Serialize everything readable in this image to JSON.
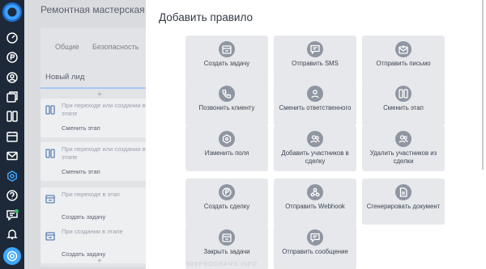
{
  "app": {
    "title": "Ремонтная мастерская",
    "tabs": [
      "Общие",
      "Безопасность"
    ],
    "stage": {
      "title": "Новый лид",
      "add_label": "+",
      "cards": [
        {
          "text": "При переходе или создании в этапе",
          "action": "Сменить этап",
          "icon": "stage-icon"
        },
        {
          "text": "При переходе или создании в этапе",
          "action": "Сменить этап",
          "icon": "stage-icon"
        },
        {
          "text": "При переходе в этап",
          "action": "Создать задачу",
          "icon": "task-icon"
        },
        {
          "text": "При создании в этапе",
          "action": "Создать задачу",
          "icon": "task-icon"
        }
      ],
      "bottom_add": "+"
    }
  },
  "modal": {
    "title": "Добавить правило",
    "rules": [
      {
        "label": "Создать задачу",
        "icon": "task-icon"
      },
      {
        "label": "Отправить SMS",
        "icon": "sms-icon"
      },
      {
        "label": "Отправить письмо",
        "icon": "mail-icon"
      },
      {
        "label": "Позвонить клиенту",
        "icon": "phone-icon"
      },
      {
        "label": "Сменить ответственного",
        "icon": "user-icon"
      },
      {
        "label": "Сменить этап",
        "icon": "stage-icon"
      },
      {
        "label": "Изменить поля",
        "icon": "fields-icon"
      },
      {
        "label": "Добавить участников в сделку",
        "icon": "add-members-icon"
      },
      {
        "label": "Удалить участников из сделки",
        "icon": "remove-members-icon"
      },
      {
        "label": "Создать сделку",
        "icon": "deal-icon"
      },
      {
        "label": "Отправить Webhook",
        "icon": "webhook-icon"
      },
      {
        "label": "Сгенерировать документ",
        "icon": "document-icon"
      },
      {
        "label": "Закрыть задачи",
        "icon": "close-tasks-icon"
      },
      {
        "label": "Отправить сообщение",
        "icon": "message-icon"
      }
    ]
  },
  "watermark": "90XPROGRAMS.INFO",
  "colors": {
    "rail": "#1d2939",
    "accent": "#3fa7ff",
    "tile": "#e6e8eb",
    "tile_icon": "#8f96a2"
  }
}
